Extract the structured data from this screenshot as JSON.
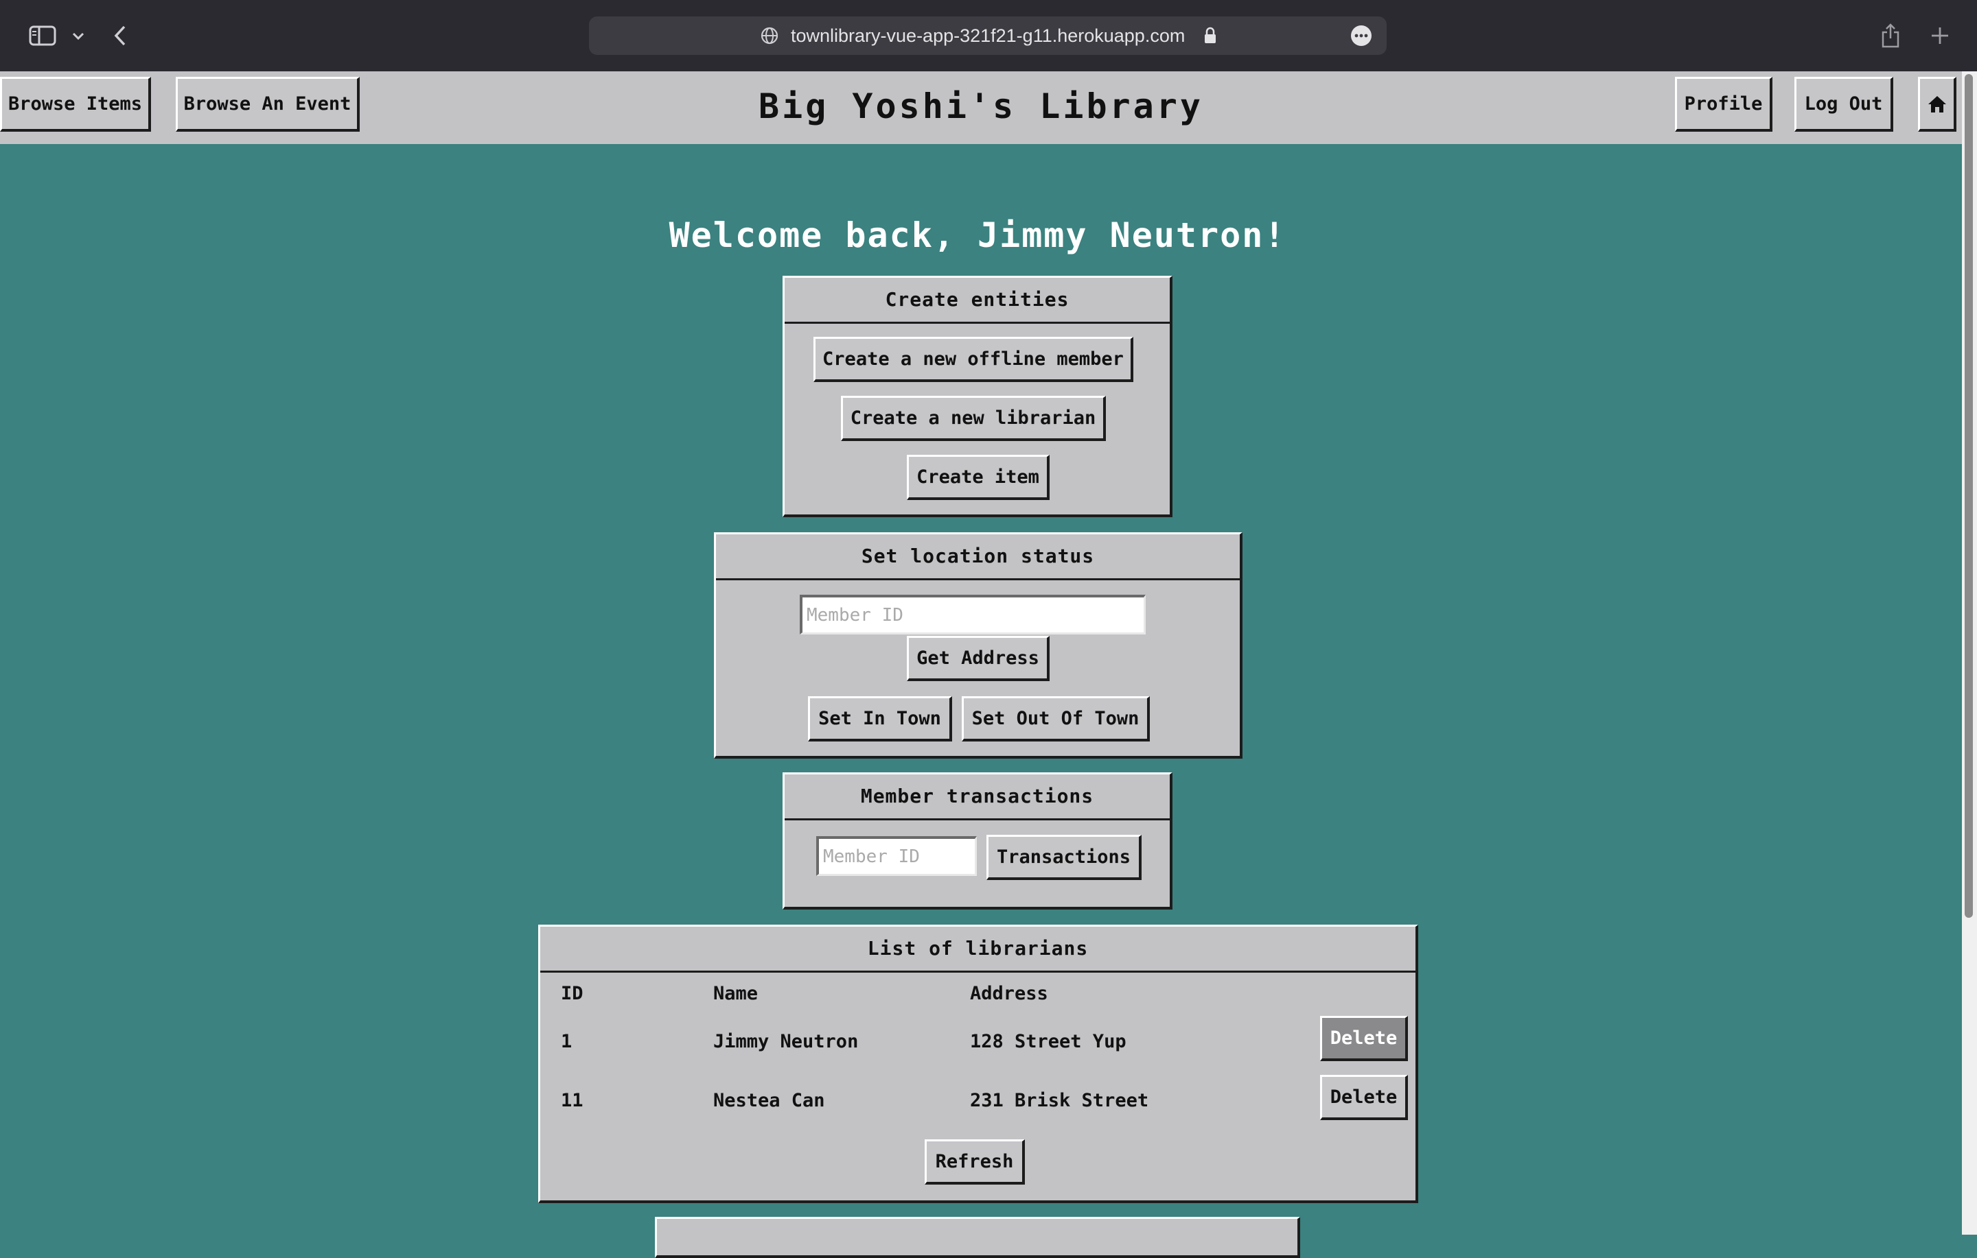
{
  "browser": {
    "url": "townlibrary-vue-app-321f21-g11.herokuapp.com",
    "icons": [
      "sidebar-icon",
      "chevron-down-icon",
      "back-icon",
      "globe-icon",
      "lock-icon",
      "more-icon",
      "share-icon",
      "plus-icon"
    ]
  },
  "header": {
    "title": "Big Yoshi's Library",
    "browse_items": "Browse Items",
    "browse_event": "Browse An Event",
    "profile": "Profile",
    "logout": "Log Out",
    "home_icon": "home-icon"
  },
  "welcome": "Welcome back, Jimmy Neutron!",
  "create_panel": {
    "title": "Create entities",
    "offline_member": "Create a new offline member",
    "librarian": "Create a new librarian",
    "item": "Create item"
  },
  "location_panel": {
    "title": "Set location status",
    "member_placeholder": "Member ID",
    "get_address": "Get Address",
    "in_town": "Set In Town",
    "out_of_town": "Set Out Of Town"
  },
  "transactions_panel": {
    "title": "Member transactions",
    "member_placeholder": "Member ID",
    "button": "Transactions"
  },
  "librarians_panel": {
    "title": "List of librarians",
    "columns": [
      "ID",
      "Name",
      "Address"
    ],
    "rows": [
      {
        "id": "1",
        "name": "Jimmy Neutron",
        "address": "128 Street Yup",
        "action": "Delete"
      },
      {
        "id": "11",
        "name": "Nestea Can",
        "address": "231 Brisk Street",
        "action": "Delete"
      }
    ],
    "refresh": "Refresh"
  },
  "colors": {
    "background": "#3b8280",
    "panel": "#c3c3c6",
    "chrome": "#2b2a30"
  }
}
